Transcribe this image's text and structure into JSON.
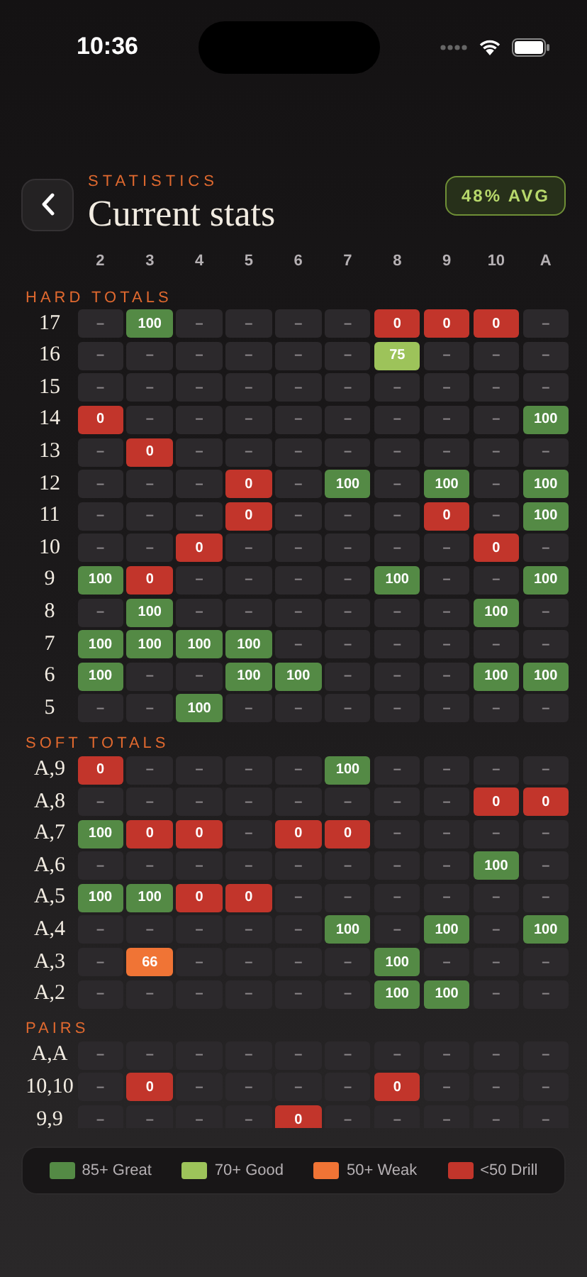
{
  "status_bar": {
    "time": "10:36"
  },
  "header": {
    "eyebrow": "STATISTICS",
    "title": "Current stats",
    "badge": "48% AVG"
  },
  "columns": [
    "2",
    "3",
    "4",
    "5",
    "6",
    "7",
    "8",
    "9",
    "10",
    "A"
  ],
  "sections": [
    {
      "title": "HARD TOTALS",
      "rows": [
        {
          "label": "17",
          "cells": [
            {
              "value": "–",
              "kind": "none"
            },
            {
              "value": "100",
              "kind": "great"
            },
            {
              "value": "–",
              "kind": "none"
            },
            {
              "value": "–",
              "kind": "none"
            },
            {
              "value": "–",
              "kind": "none"
            },
            {
              "value": "–",
              "kind": "none"
            },
            {
              "value": "0",
              "kind": "drill"
            },
            {
              "value": "0",
              "kind": "drill"
            },
            {
              "value": "0",
              "kind": "drill"
            },
            {
              "value": "–",
              "kind": "none"
            }
          ]
        },
        {
          "label": "16",
          "cells": [
            {
              "value": "–",
              "kind": "none"
            },
            {
              "value": "–",
              "kind": "none"
            },
            {
              "value": "–",
              "kind": "none"
            },
            {
              "value": "–",
              "kind": "none"
            },
            {
              "value": "–",
              "kind": "none"
            },
            {
              "value": "–",
              "kind": "none"
            },
            {
              "value": "75",
              "kind": "good"
            },
            {
              "value": "–",
              "kind": "none"
            },
            {
              "value": "–",
              "kind": "none"
            },
            {
              "value": "–",
              "kind": "none"
            }
          ]
        },
        {
          "label": "15",
          "cells": [
            {
              "value": "–",
              "kind": "none"
            },
            {
              "value": "–",
              "kind": "none"
            },
            {
              "value": "–",
              "kind": "none"
            },
            {
              "value": "–",
              "kind": "none"
            },
            {
              "value": "–",
              "kind": "none"
            },
            {
              "value": "–",
              "kind": "none"
            },
            {
              "value": "–",
              "kind": "none"
            },
            {
              "value": "–",
              "kind": "none"
            },
            {
              "value": "–",
              "kind": "none"
            },
            {
              "value": "–",
              "kind": "none"
            }
          ]
        },
        {
          "label": "14",
          "cells": [
            {
              "value": "0",
              "kind": "drill"
            },
            {
              "value": "–",
              "kind": "none"
            },
            {
              "value": "–",
              "kind": "none"
            },
            {
              "value": "–",
              "kind": "none"
            },
            {
              "value": "–",
              "kind": "none"
            },
            {
              "value": "–",
              "kind": "none"
            },
            {
              "value": "–",
              "kind": "none"
            },
            {
              "value": "–",
              "kind": "none"
            },
            {
              "value": "–",
              "kind": "none"
            },
            {
              "value": "100",
              "kind": "great"
            }
          ]
        },
        {
          "label": "13",
          "cells": [
            {
              "value": "–",
              "kind": "none"
            },
            {
              "value": "0",
              "kind": "drill"
            },
            {
              "value": "–",
              "kind": "none"
            },
            {
              "value": "–",
              "kind": "none"
            },
            {
              "value": "–",
              "kind": "none"
            },
            {
              "value": "–",
              "kind": "none"
            },
            {
              "value": "–",
              "kind": "none"
            },
            {
              "value": "–",
              "kind": "none"
            },
            {
              "value": "–",
              "kind": "none"
            },
            {
              "value": "–",
              "kind": "none"
            }
          ]
        },
        {
          "label": "12",
          "cells": [
            {
              "value": "–",
              "kind": "none"
            },
            {
              "value": "–",
              "kind": "none"
            },
            {
              "value": "–",
              "kind": "none"
            },
            {
              "value": "0",
              "kind": "drill"
            },
            {
              "value": "–",
              "kind": "none"
            },
            {
              "value": "100",
              "kind": "great"
            },
            {
              "value": "–",
              "kind": "none"
            },
            {
              "value": "100",
              "kind": "great"
            },
            {
              "value": "–",
              "kind": "none"
            },
            {
              "value": "100",
              "kind": "great"
            }
          ]
        },
        {
          "label": "11",
          "cells": [
            {
              "value": "–",
              "kind": "none"
            },
            {
              "value": "–",
              "kind": "none"
            },
            {
              "value": "–",
              "kind": "none"
            },
            {
              "value": "0",
              "kind": "drill"
            },
            {
              "value": "–",
              "kind": "none"
            },
            {
              "value": "–",
              "kind": "none"
            },
            {
              "value": "–",
              "kind": "none"
            },
            {
              "value": "0",
              "kind": "drill"
            },
            {
              "value": "–",
              "kind": "none"
            },
            {
              "value": "100",
              "kind": "great"
            }
          ]
        },
        {
          "label": "10",
          "cells": [
            {
              "value": "–",
              "kind": "none"
            },
            {
              "value": "–",
              "kind": "none"
            },
            {
              "value": "0",
              "kind": "drill"
            },
            {
              "value": "–",
              "kind": "none"
            },
            {
              "value": "–",
              "kind": "none"
            },
            {
              "value": "–",
              "kind": "none"
            },
            {
              "value": "–",
              "kind": "none"
            },
            {
              "value": "–",
              "kind": "none"
            },
            {
              "value": "0",
              "kind": "drill"
            },
            {
              "value": "–",
              "kind": "none"
            }
          ]
        },
        {
          "label": "9",
          "cells": [
            {
              "value": "100",
              "kind": "great"
            },
            {
              "value": "0",
              "kind": "drill"
            },
            {
              "value": "–",
              "kind": "none"
            },
            {
              "value": "–",
              "kind": "none"
            },
            {
              "value": "–",
              "kind": "none"
            },
            {
              "value": "–",
              "kind": "none"
            },
            {
              "value": "100",
              "kind": "great"
            },
            {
              "value": "–",
              "kind": "none"
            },
            {
              "value": "–",
              "kind": "none"
            },
            {
              "value": "100",
              "kind": "great"
            }
          ]
        },
        {
          "label": "8",
          "cells": [
            {
              "value": "–",
              "kind": "none"
            },
            {
              "value": "100",
              "kind": "great"
            },
            {
              "value": "–",
              "kind": "none"
            },
            {
              "value": "–",
              "kind": "none"
            },
            {
              "value": "–",
              "kind": "none"
            },
            {
              "value": "–",
              "kind": "none"
            },
            {
              "value": "–",
              "kind": "none"
            },
            {
              "value": "–",
              "kind": "none"
            },
            {
              "value": "100",
              "kind": "great"
            },
            {
              "value": "–",
              "kind": "none"
            }
          ]
        },
        {
          "label": "7",
          "cells": [
            {
              "value": "100",
              "kind": "great"
            },
            {
              "value": "100",
              "kind": "great"
            },
            {
              "value": "100",
              "kind": "great"
            },
            {
              "value": "100",
              "kind": "great"
            },
            {
              "value": "–",
              "kind": "none"
            },
            {
              "value": "–",
              "kind": "none"
            },
            {
              "value": "–",
              "kind": "none"
            },
            {
              "value": "–",
              "kind": "none"
            },
            {
              "value": "–",
              "kind": "none"
            },
            {
              "value": "–",
              "kind": "none"
            }
          ]
        },
        {
          "label": "6",
          "cells": [
            {
              "value": "100",
              "kind": "great"
            },
            {
              "value": "–",
              "kind": "none"
            },
            {
              "value": "–",
              "kind": "none"
            },
            {
              "value": "100",
              "kind": "great"
            },
            {
              "value": "100",
              "kind": "great"
            },
            {
              "value": "–",
              "kind": "none"
            },
            {
              "value": "–",
              "kind": "none"
            },
            {
              "value": "–",
              "kind": "none"
            },
            {
              "value": "100",
              "kind": "great"
            },
            {
              "value": "100",
              "kind": "great"
            }
          ]
        },
        {
          "label": "5",
          "cells": [
            {
              "value": "–",
              "kind": "none"
            },
            {
              "value": "–",
              "kind": "none"
            },
            {
              "value": "100",
              "kind": "great"
            },
            {
              "value": "–",
              "kind": "none"
            },
            {
              "value": "–",
              "kind": "none"
            },
            {
              "value": "–",
              "kind": "none"
            },
            {
              "value": "–",
              "kind": "none"
            },
            {
              "value": "–",
              "kind": "none"
            },
            {
              "value": "–",
              "kind": "none"
            },
            {
              "value": "–",
              "kind": "none"
            }
          ]
        }
      ]
    },
    {
      "title": "SOFT TOTALS",
      "rows": [
        {
          "label": "A,9",
          "cells": [
            {
              "value": "0",
              "kind": "drill"
            },
            {
              "value": "–",
              "kind": "none"
            },
            {
              "value": "–",
              "kind": "none"
            },
            {
              "value": "–",
              "kind": "none"
            },
            {
              "value": "–",
              "kind": "none"
            },
            {
              "value": "100",
              "kind": "great"
            },
            {
              "value": "–",
              "kind": "none"
            },
            {
              "value": "–",
              "kind": "none"
            },
            {
              "value": "–",
              "kind": "none"
            },
            {
              "value": "–",
              "kind": "none"
            }
          ]
        },
        {
          "label": "A,8",
          "cells": [
            {
              "value": "–",
              "kind": "none"
            },
            {
              "value": "–",
              "kind": "none"
            },
            {
              "value": "–",
              "kind": "none"
            },
            {
              "value": "–",
              "kind": "none"
            },
            {
              "value": "–",
              "kind": "none"
            },
            {
              "value": "–",
              "kind": "none"
            },
            {
              "value": "–",
              "kind": "none"
            },
            {
              "value": "–",
              "kind": "none"
            },
            {
              "value": "0",
              "kind": "drill"
            },
            {
              "value": "0",
              "kind": "drill"
            }
          ]
        },
        {
          "label": "A,7",
          "cells": [
            {
              "value": "100",
              "kind": "great"
            },
            {
              "value": "0",
              "kind": "drill"
            },
            {
              "value": "0",
              "kind": "drill"
            },
            {
              "value": "–",
              "kind": "none"
            },
            {
              "value": "0",
              "kind": "drill"
            },
            {
              "value": "0",
              "kind": "drill"
            },
            {
              "value": "–",
              "kind": "none"
            },
            {
              "value": "–",
              "kind": "none"
            },
            {
              "value": "–",
              "kind": "none"
            },
            {
              "value": "–",
              "kind": "none"
            }
          ]
        },
        {
          "label": "A,6",
          "cells": [
            {
              "value": "–",
              "kind": "none"
            },
            {
              "value": "–",
              "kind": "none"
            },
            {
              "value": "–",
              "kind": "none"
            },
            {
              "value": "–",
              "kind": "none"
            },
            {
              "value": "–",
              "kind": "none"
            },
            {
              "value": "–",
              "kind": "none"
            },
            {
              "value": "–",
              "kind": "none"
            },
            {
              "value": "–",
              "kind": "none"
            },
            {
              "value": "100",
              "kind": "great"
            },
            {
              "value": "–",
              "kind": "none"
            }
          ]
        },
        {
          "label": "A,5",
          "cells": [
            {
              "value": "100",
              "kind": "great"
            },
            {
              "value": "100",
              "kind": "great"
            },
            {
              "value": "0",
              "kind": "drill"
            },
            {
              "value": "0",
              "kind": "drill"
            },
            {
              "value": "–",
              "kind": "none"
            },
            {
              "value": "–",
              "kind": "none"
            },
            {
              "value": "–",
              "kind": "none"
            },
            {
              "value": "–",
              "kind": "none"
            },
            {
              "value": "–",
              "kind": "none"
            },
            {
              "value": "–",
              "kind": "none"
            }
          ]
        },
        {
          "label": "A,4",
          "cells": [
            {
              "value": "–",
              "kind": "none"
            },
            {
              "value": "–",
              "kind": "none"
            },
            {
              "value": "–",
              "kind": "none"
            },
            {
              "value": "–",
              "kind": "none"
            },
            {
              "value": "–",
              "kind": "none"
            },
            {
              "value": "100",
              "kind": "great"
            },
            {
              "value": "–",
              "kind": "none"
            },
            {
              "value": "100",
              "kind": "great"
            },
            {
              "value": "–",
              "kind": "none"
            },
            {
              "value": "100",
              "kind": "great"
            }
          ]
        },
        {
          "label": "A,3",
          "cells": [
            {
              "value": "–",
              "kind": "none"
            },
            {
              "value": "66",
              "kind": "weak"
            },
            {
              "value": "–",
              "kind": "none"
            },
            {
              "value": "–",
              "kind": "none"
            },
            {
              "value": "–",
              "kind": "none"
            },
            {
              "value": "–",
              "kind": "none"
            },
            {
              "value": "100",
              "kind": "great"
            },
            {
              "value": "–",
              "kind": "none"
            },
            {
              "value": "–",
              "kind": "none"
            },
            {
              "value": "–",
              "kind": "none"
            }
          ]
        },
        {
          "label": "A,2",
          "cells": [
            {
              "value": "–",
              "kind": "none"
            },
            {
              "value": "–",
              "kind": "none"
            },
            {
              "value": "–",
              "kind": "none"
            },
            {
              "value": "–",
              "kind": "none"
            },
            {
              "value": "–",
              "kind": "none"
            },
            {
              "value": "–",
              "kind": "none"
            },
            {
              "value": "100",
              "kind": "great"
            },
            {
              "value": "100",
              "kind": "great"
            },
            {
              "value": "–",
              "kind": "none"
            },
            {
              "value": "–",
              "kind": "none"
            }
          ]
        }
      ]
    },
    {
      "title": "PAIRS",
      "rows": [
        {
          "label": "A,A",
          "cells": [
            {
              "value": "–",
              "kind": "none"
            },
            {
              "value": "–",
              "kind": "none"
            },
            {
              "value": "–",
              "kind": "none"
            },
            {
              "value": "–",
              "kind": "none"
            },
            {
              "value": "–",
              "kind": "none"
            },
            {
              "value": "–",
              "kind": "none"
            },
            {
              "value": "–",
              "kind": "none"
            },
            {
              "value": "–",
              "kind": "none"
            },
            {
              "value": "–",
              "kind": "none"
            },
            {
              "value": "–",
              "kind": "none"
            }
          ]
        },
        {
          "label": "10,10",
          "cells": [
            {
              "value": "–",
              "kind": "none"
            },
            {
              "value": "0",
              "kind": "drill"
            },
            {
              "value": "–",
              "kind": "none"
            },
            {
              "value": "–",
              "kind": "none"
            },
            {
              "value": "–",
              "kind": "none"
            },
            {
              "value": "–",
              "kind": "none"
            },
            {
              "value": "0",
              "kind": "drill"
            },
            {
              "value": "–",
              "kind": "none"
            },
            {
              "value": "–",
              "kind": "none"
            },
            {
              "value": "–",
              "kind": "none"
            }
          ]
        },
        {
          "label": "9,9",
          "cells": [
            {
              "value": "–",
              "kind": "none"
            },
            {
              "value": "–",
              "kind": "none"
            },
            {
              "value": "–",
              "kind": "none"
            },
            {
              "value": "–",
              "kind": "none"
            },
            {
              "value": "0",
              "kind": "drill"
            },
            {
              "value": "–",
              "kind": "none"
            },
            {
              "value": "–",
              "kind": "none"
            },
            {
              "value": "–",
              "kind": "none"
            },
            {
              "value": "–",
              "kind": "none"
            },
            {
              "value": "–",
              "kind": "none"
            }
          ]
        }
      ]
    }
  ],
  "legend": [
    {
      "label": "85+ Great",
      "color": "#548a45"
    },
    {
      "label": "70+ Good",
      "color": "#9dc35a"
    },
    {
      "label": "50+ Weak",
      "color": "#f07435"
    },
    {
      "label": "<50 Drill",
      "color": "#c2352b"
    }
  ]
}
